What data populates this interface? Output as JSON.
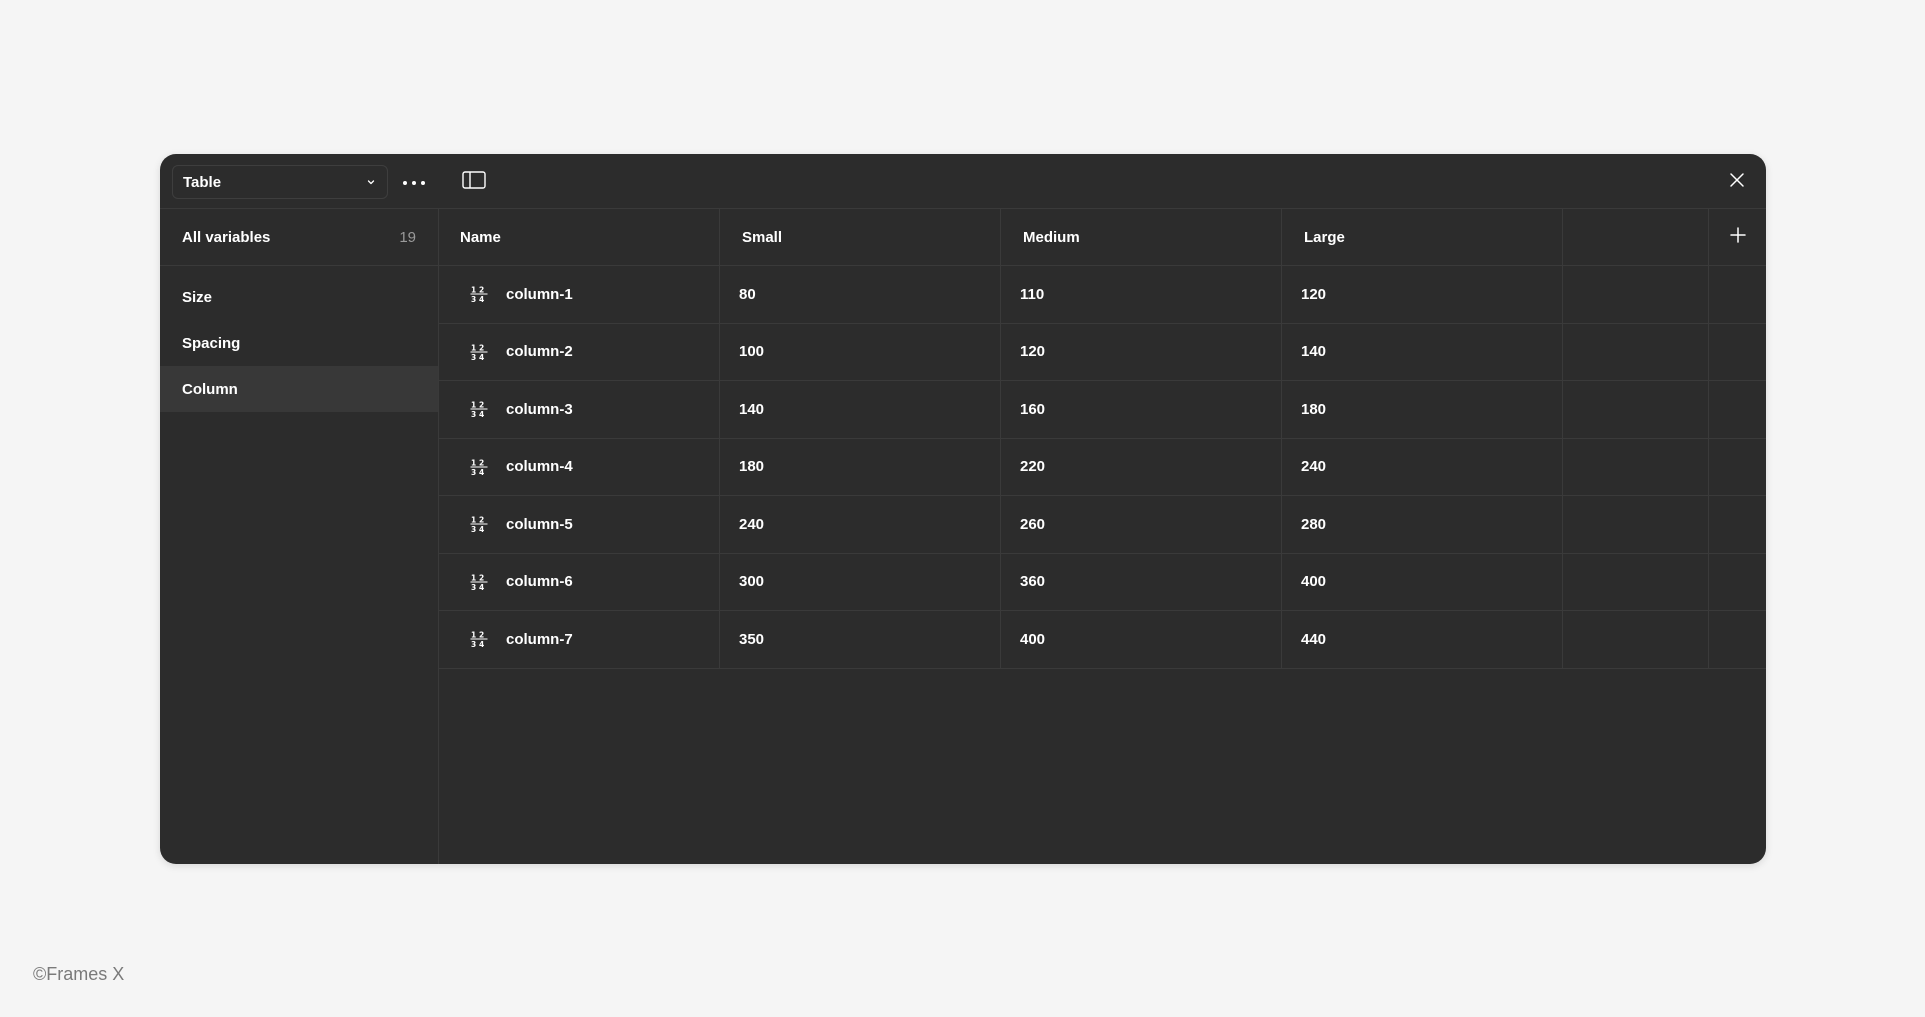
{
  "header": {
    "collection_label": "Table",
    "chevron_icon": "chevron-down-icon",
    "more_icon": "more-horizontal-icon",
    "sidebar_toggle_icon": "sidebar-panel-icon",
    "close_icon": "close-icon"
  },
  "sidebar": {
    "all_variables_label": "All variables",
    "all_variables_count": "19",
    "groups": [
      {
        "label": "Size",
        "active": false
      },
      {
        "label": "Spacing",
        "active": false
      },
      {
        "label": "Column",
        "active": true
      }
    ]
  },
  "table": {
    "columns": [
      "Name",
      "Small",
      "Medium",
      "Large"
    ],
    "add_column_icon": "plus-icon",
    "row_icon": "number-variable-icon",
    "rows": [
      {
        "name": "column-1",
        "small": "80",
        "medium": "110",
        "large": "120"
      },
      {
        "name": "column-2",
        "small": "100",
        "medium": "120",
        "large": "140"
      },
      {
        "name": "column-3",
        "small": "140",
        "medium": "160",
        "large": "180"
      },
      {
        "name": "column-4",
        "small": "180",
        "medium": "220",
        "large": "240"
      },
      {
        "name": "column-5",
        "small": "240",
        "medium": "260",
        "large": "280"
      },
      {
        "name": "column-6",
        "small": "300",
        "medium": "360",
        "large": "400"
      },
      {
        "name": "column-7",
        "small": "350",
        "medium": "400",
        "large": "440"
      }
    ]
  },
  "footer": {
    "copyright": "©Frames X"
  },
  "colors": {
    "page_bg": "#f5f5f5",
    "panel_bg": "#2c2c2c",
    "active_bg": "#383838",
    "border": "#3a3a3a",
    "muted_text": "#9a9a9a"
  }
}
